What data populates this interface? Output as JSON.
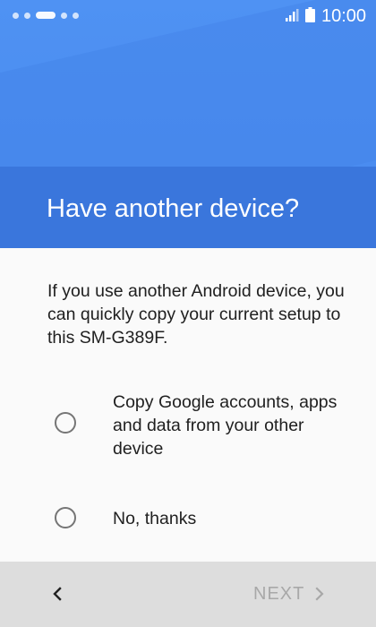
{
  "status_bar": {
    "time": "10:00",
    "icons": [
      "notification-dots-icon",
      "signal-icon",
      "battery-icon"
    ]
  },
  "header": {
    "title": "Have another device?"
  },
  "content": {
    "description": "If you use another Android device, you can quickly copy your current setup to this SM-G389F.",
    "options": [
      {
        "label": "Copy Google accounts, apps and data from your other device",
        "selected": false
      },
      {
        "label": "No, thanks",
        "selected": false
      }
    ]
  },
  "navigation": {
    "back_icon": "chevron-left-icon",
    "next_label": "NEXT",
    "next_icon": "chevron-right-icon"
  },
  "colors": {
    "header_blue": "#4a8cf0",
    "title_band_blue": "#3a76dc",
    "nav_bar": "#dddddd",
    "disabled_text": "#a8a8a8"
  }
}
